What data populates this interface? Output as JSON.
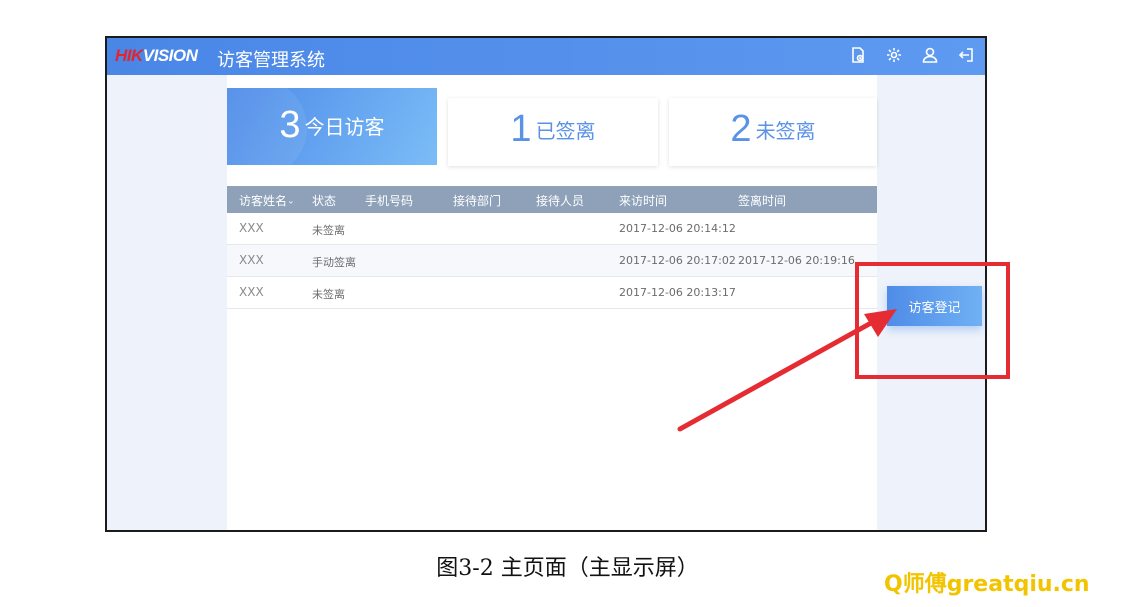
{
  "app": {
    "brand_red": "HIK",
    "brand_white": "VISION",
    "title": "访客管理系统",
    "toolbar_icons": [
      "document-icon",
      "gear-icon",
      "user-icon",
      "logout-icon"
    ]
  },
  "stats": [
    {
      "value": "3",
      "label": "今日访客",
      "active": true
    },
    {
      "value": "1",
      "label": "已签离",
      "active": false
    },
    {
      "value": "2",
      "label": "未签离",
      "active": false
    }
  ],
  "table": {
    "columns": [
      "访客姓名",
      "状态",
      "手机号码",
      "接待部门",
      "接待人员",
      "来访时间",
      "签离时间"
    ],
    "rows": [
      {
        "name": "XXX",
        "status": "未签离",
        "phone": "",
        "dept": "",
        "host": "",
        "visit_time": "2017-12-06 20:14:12",
        "leave_time": ""
      },
      {
        "name": "XXX",
        "status": "手动签离",
        "phone": "",
        "dept": "",
        "host": "",
        "visit_time": "2017-12-06 20:17:02",
        "leave_time": "2017-12-06 20:19:16"
      },
      {
        "name": "XXX",
        "status": "未签离",
        "phone": "",
        "dept": "",
        "host": "",
        "visit_time": "2017-12-06 20:13:17",
        "leave_time": ""
      }
    ]
  },
  "register_button": "访客登记",
  "caption": "图3-2  主页面（主显示屏）",
  "watermark": "Q师傅greatqiu.cn",
  "colors": {
    "titlebar": "#4a86e6",
    "accent": "#5a92e6",
    "table_header": "#8ea1b8",
    "highlight": "#e52c33",
    "watermark": "#f2c400"
  }
}
